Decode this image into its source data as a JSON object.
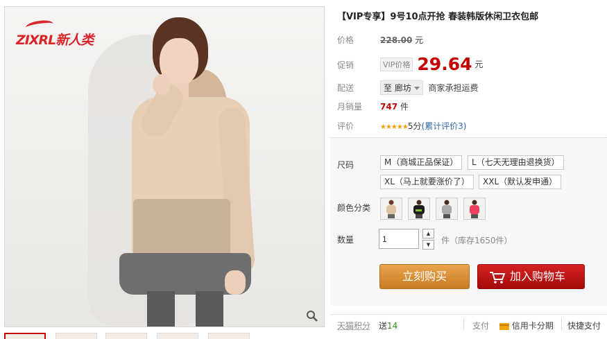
{
  "gallery": {
    "brand_logo_text": "ZIXRL新人类",
    "zoom_icon": "magnifier-icon",
    "thumbnail_count": 5
  },
  "product": {
    "title": "【VIP专享】9号10点开抢 春装韩版休闲卫衣包邮"
  },
  "price_row": {
    "label": "价格",
    "value": "228.00",
    "unit": "元"
  },
  "promo_row": {
    "label": "促销",
    "tag": "VIP价格",
    "price": "29.64",
    "unit": "元"
  },
  "delivery_row": {
    "label": "配送",
    "to_prefix": "至",
    "city": "廊坊",
    "shipping_note": "商家承担运费"
  },
  "sales_row": {
    "label": "月销量",
    "count": "747",
    "unit": "件"
  },
  "rating_row": {
    "label": "评价",
    "stars": "★★★★★",
    "score": "5分",
    "reviews": "(累计评价3)"
  },
  "size": {
    "label": "尺码",
    "options": [
      "M（商城正品保证）",
      "L（七天无理由退换货）",
      "XL（马上就要涨价了）",
      "XXL（默认发申通）"
    ]
  },
  "color": {
    "label": "颜色分类",
    "swatches": [
      "beige",
      "black",
      "grey",
      "pink"
    ]
  },
  "quantity": {
    "label": "数量",
    "value": "1",
    "stock_text": "件（库存1650件）"
  },
  "actions": {
    "buy_now": "立刻购买",
    "add_to_cart": "加入购物车"
  },
  "footer": {
    "points_label": "天猫积分",
    "points_prefix": "送",
    "points_value": "14",
    "pay_label": "支付",
    "credit_card": "信用卡分期",
    "express_pay": "快捷支付"
  },
  "colors": {
    "accent_red": "#c40000",
    "buy_orange": "#d98a32",
    "cart_red": "#b81010"
  }
}
